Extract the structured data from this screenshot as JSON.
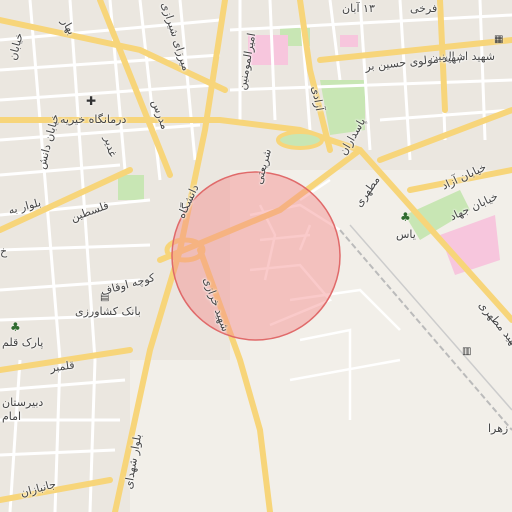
{
  "map": {
    "colors": {
      "background": "#f2efe9",
      "major_road": "#f7d57a",
      "minor_road": "#ffffff",
      "park": "#c8e6b4",
      "residential": "#ebe7e0",
      "highlight_fill": "#f48a8a",
      "highlight_stroke": "#e06a6a",
      "pink_zone": "#f7c6dd"
    },
    "labels": {
      "label_13aban": "۱۳ آبان",
      "label_farkhi": "فرخی",
      "label_ommolbanin": "شهید ام البنین",
      "label_molavi_hossein": "شهید مولوی حسین بر",
      "label_azadi": "آزادی",
      "label_paasdaran": "پاسداران",
      "label_motahari_top": "مطهری",
      "label_amirmomenin": "امیرالمومنین",
      "label_emam_jafar": "میرزای شیرازی",
      "label_bahar": "بهار",
      "label_darmangah": "درمانگاه خیریه",
      "label_khiaban_ghadir": "غدیر",
      "label_modares": "مدرس",
      "label_danesh": "خیابان دانش",
      "label_falestin": "فلسطین",
      "label_bolvar_b": "بلوار به",
      "label_daneshgah": "دانشگاه",
      "label_shariati": "شریعتی",
      "label_yas": "یاس",
      "label_khiaban_azad": "خیابان آزاد",
      "label_khiaban_jahad": "خیابان جهاد",
      "label_motahari_right": "شهید مطهری",
      "label_kooche_oghaf": "کوچه اوقاف",
      "label_bank_keshavarzi": "بانک کشاورزی",
      "label_park_ghalam": "پارک قلم",
      "label_dabirestan": "دبیرستان",
      "label_emam": "امام",
      "label_ghalambar": "قلمبر",
      "label_shahid_kharazi": "شهید خرازی",
      "label_bolvar_shohada": "بلوار شهدای",
      "label_janbazan": "جانبازان",
      "label_zahra": "زهرا",
      "label_kh": "خ",
      "label_khiaban_top_left": "خیابان"
    },
    "icons": {
      "hospital": "hospital-cross-icon",
      "tree_park": "tree-icon",
      "bank": "bank-icon",
      "train": "train-station-icon",
      "school": "school-icon"
    },
    "highlight_area": {
      "shape": "circle"
    }
  }
}
